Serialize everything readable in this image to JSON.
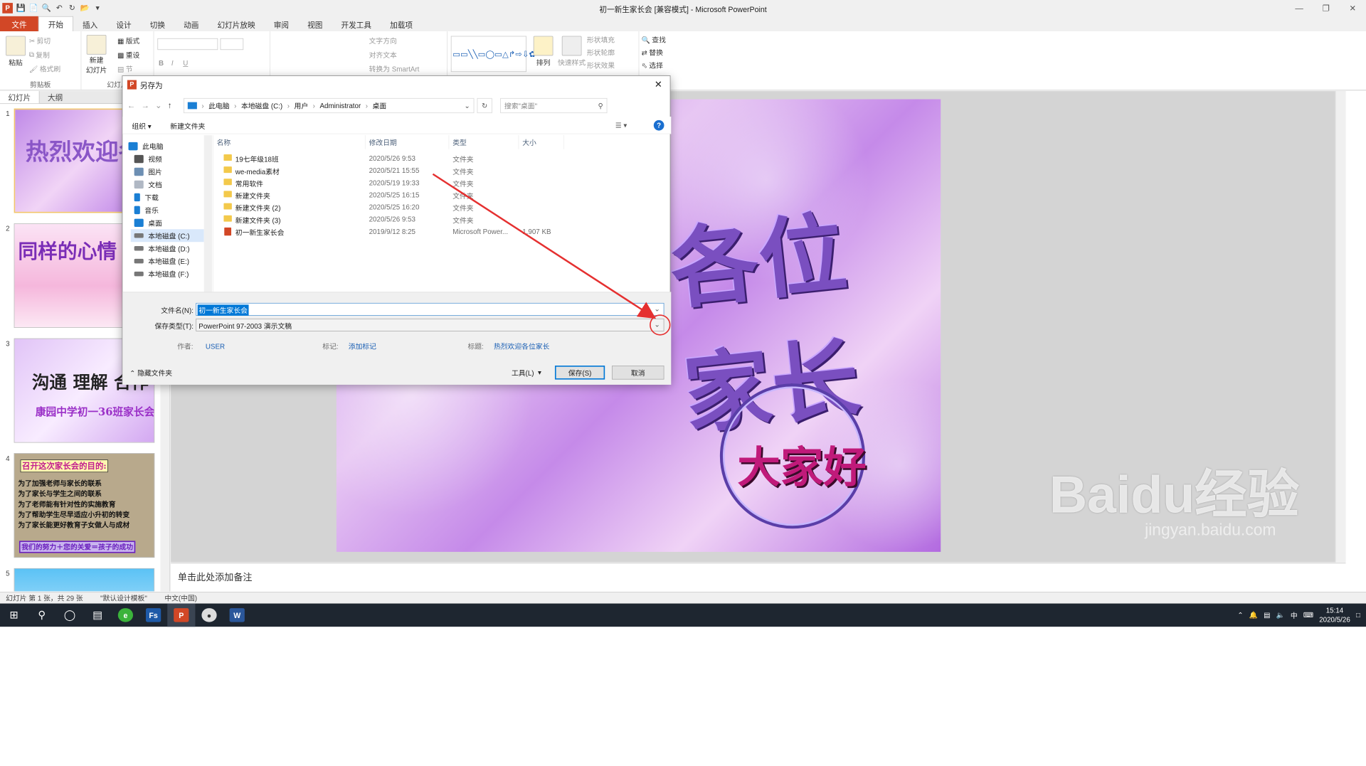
{
  "window": {
    "title": "初一新生家长会 [兼容模式] - Microsoft PowerPoint"
  },
  "ribbon": {
    "tabs": [
      "文件",
      "开始",
      "插入",
      "设计",
      "切换",
      "动画",
      "幻灯片放映",
      "审阅",
      "视图",
      "开发工具",
      "加载项"
    ],
    "clipboard": {
      "paste": "粘贴",
      "cut": "剪切",
      "copy": "复制",
      "format": "格式刷",
      "label": "剪贴板"
    },
    "slides": {
      "new": "新建",
      "new2": "幻灯片",
      "layout": "版式",
      "reset": "重设",
      "section": "节",
      "label": "幻灯片"
    },
    "paragraph": {
      "textdir": "文字方向",
      "align": "对齐文本",
      "smartart": "转换为 SmartArt"
    },
    "drawing": {
      "arrange": "排列",
      "quickstyle": "快速样式",
      "fill": "形状填充",
      "outline": "形状轮廓",
      "effect": "形状效果"
    },
    "editing": {
      "find": "查找",
      "replace": "替换",
      "select": "选择"
    }
  },
  "panel": {
    "tab_slides": "幻灯片",
    "tab_outline": "大纲"
  },
  "thumbs": [
    {
      "num": "1",
      "text": "热烈欢迎各位"
    },
    {
      "num": "2",
      "text": "同样的心情 一样的"
    },
    {
      "num": "3",
      "line1": "沟通  理解  合作",
      "line2": "康园中学初一36班家长会"
    },
    {
      "num": "4",
      "title": "召开这次家长会的目的:",
      "lines": [
        "为了加强老师与家长的联系",
        "为了家长与学生之间的联系",
        "为了老师能有针对性的实施教育",
        "为了帮助学生尽早适应小升初的转变",
        "为了家长能更好教育子女做人与成材"
      ],
      "footer": "我们的努力＋您的关爱＝孩子的成功"
    },
    {
      "num": "5"
    }
  ],
  "slide": {
    "title": "各位家长",
    "greeting": "大家好"
  },
  "notes": {
    "placeholder": "单击此处添加备注"
  },
  "status": {
    "slide": "幻灯片 第 1 张，共 29 张",
    "theme": "\"默认设计模板\"",
    "lang": "中文(中国)"
  },
  "dialog": {
    "title": "另存为",
    "breadcrumb": [
      "此电脑",
      "本地磁盘 (C:)",
      "用户",
      "Administrator",
      "桌面"
    ],
    "search_placeholder": "搜索\"桌面\"",
    "organize": "组织",
    "new_folder": "新建文件夹",
    "nav": [
      "此电脑",
      "视频",
      "图片",
      "文档",
      "下载",
      "音乐",
      "桌面",
      "本地磁盘 (C:)",
      "本地磁盘 (D:)",
      "本地磁盘 (E:)",
      "本地磁盘 (F:)"
    ],
    "columns": [
      "名称",
      "修改日期",
      "类型",
      "大小"
    ],
    "files": [
      {
        "name": "19七年级18班",
        "date": "2020/5/26 9:53",
        "type": "文件夹",
        "size": ""
      },
      {
        "name": "we-media素材",
        "date": "2020/5/21 15:55",
        "type": "文件夹",
        "size": ""
      },
      {
        "name": "常用软件",
        "date": "2020/5/19 19:33",
        "type": "文件夹",
        "size": ""
      },
      {
        "name": "新建文件夹",
        "date": "2020/5/25 16:15",
        "type": "文件夹",
        "size": ""
      },
      {
        "name": "新建文件夹 (2)",
        "date": "2020/5/25 16:20",
        "type": "文件夹",
        "size": ""
      },
      {
        "name": "新建文件夹 (3)",
        "date": "2020/5/26 9:53",
        "type": "文件夹",
        "size": ""
      },
      {
        "name": "初一新生家长会",
        "date": "2019/9/12 8:25",
        "type": "Microsoft Power...",
        "size": "1,907 KB"
      }
    ],
    "filename_label": "文件名(N):",
    "filename_value": "初一新生家长会",
    "filetype_label": "保存类型(T):",
    "filetype_value": "PowerPoint 97-2003 演示文稿",
    "author_label": "作者:",
    "author_value": "USER",
    "tags_label": "标记:",
    "tags_value": "添加标记",
    "title_label": "标题:",
    "title_value": "热烈欢迎各位家长",
    "hide_folders": "隐藏文件夹",
    "tools": "工具(L)",
    "save": "保存(S)",
    "cancel": "取消"
  },
  "taskbar": {
    "time": "15:14",
    "date": "2020/5/26",
    "ime": "中"
  },
  "watermark": {
    "brand": "Baidu经验",
    "url": "jingyan.baidu.com"
  }
}
